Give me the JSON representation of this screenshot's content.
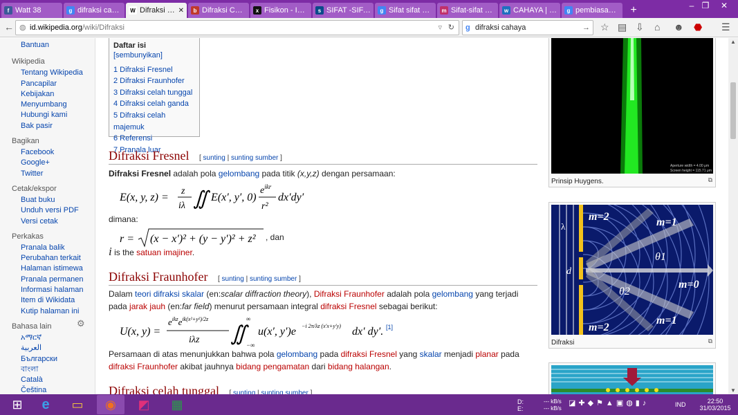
{
  "tabs": [
    {
      "label": "Watt 38",
      "icon": "f"
    },
    {
      "label": "difraksi caha...",
      "icon": "g"
    },
    {
      "label": "Difraksi - ...",
      "icon": "W",
      "active": true
    },
    {
      "label": "Difraksi Cah...",
      "icon": "b"
    },
    {
      "label": "Fisikon - Inte...",
      "icon": "x"
    },
    {
      "label": "SIFAT -SIFAT...",
      "icon": "s"
    },
    {
      "label": "Sifat sifat ca...",
      "icon": "g"
    },
    {
      "label": "Sifat-sifat Ca...",
      "icon": "m"
    },
    {
      "label": "CAHAYA | sc...",
      "icon": "w"
    },
    {
      "label": "pembiasan a...",
      "icon": "g"
    }
  ],
  "url": {
    "host": "id.wikipedia.org",
    "path": "/wiki/Difraksi"
  },
  "search": "difraksi cahaya",
  "sidebar": {
    "top_item": "Bantuan",
    "sections": [
      {
        "title": "Wikipedia",
        "items": [
          "Tentang Wikipedia",
          "Pancapilar",
          "Kebijakan",
          "Menyumbang",
          "Hubungi kami",
          "Bak pasir"
        ]
      },
      {
        "title": "Bagikan",
        "items": [
          "Facebook",
          "Google+",
          "Twitter"
        ]
      },
      {
        "title": "Cetak/ekspor",
        "items": [
          "Buat buku",
          "Unduh versi PDF",
          "Versi cetak"
        ]
      },
      {
        "title": "Perkakas",
        "items": [
          "Pranala balik",
          "Perubahan terkait",
          "Halaman istimewa",
          "Pranala permanen",
          "Informasi halaman",
          "Item di Wikidata",
          "Kutip halaman ini"
        ]
      },
      {
        "title": "Bahasa lain",
        "items": [
          "አማርኛ",
          "العربية",
          "Български",
          "বাংলা",
          "Català",
          "Čeština"
        ]
      }
    ]
  },
  "toc": {
    "title": "Daftar isi",
    "toggle": "[sembunyikan]",
    "items": [
      "1 Difraksi Fresnel",
      "2 Difraksi Fraunhofer",
      "3 Difraksi celah tunggal",
      "4 Difraksi celah ganda",
      "5 Difraksi celah majemuk",
      "6 Referensi",
      "7 Pranala luar"
    ]
  },
  "edit": {
    "open": "[",
    "edit": "sunting",
    "sep": "|",
    "source": "sunting sumber",
    "close": "]"
  },
  "sec1": {
    "title": "Difraksi Fresnel",
    "p1_b": "Difraksi Fresnel",
    "p1_a": " adalah pola ",
    "p1_link": "gelombang",
    "p1_c": " pada titik ",
    "p1_i": "(x,y,z)",
    "p1_d": " dengan persamaan:",
    "eq1": "E(x, y, z) = (z / iλ) ∬ E(x′, y′, 0) (e^{ikr} / r²) dx′dy′",
    "dimana": "dimana:",
    "eq2": "r = √((x − x′)² + (y − y′)² + z²)",
    "dan": ", dan",
    "i_sym": "i",
    "i_text": " is the ",
    "i_link": "satuan imajiner",
    "i_end": "."
  },
  "sec2": {
    "title": "Difraksi Fraunhofer",
    "t1": "Dalam ",
    "l1": "teori",
    "t2": " ",
    "l2": "difraksi skalar",
    "t3": " (en:",
    "i1": "scalar diffraction theory",
    "t4": "), ",
    "l3": "Difraksi Fraunhofer",
    "t5": " adalah pola ",
    "l4": "gelombang",
    "t6": " yang terjadi pada ",
    "l5": "jarak jauh",
    "t7": " (en:",
    "i2": "far field",
    "t8": ") menurut persamaan integral ",
    "l6": "difraksi Fresnel",
    "t9": " sebagai berikut:",
    "eq3": "U(x, y) = (e^{ikz} e^{ik(x²+y²)/2z} / iλz) ∬ u(x′, y′) e^{−i 2π/λz (x′x + y′y)} dx′ dy′.",
    "ref": "[1]",
    "p2a": "Persamaan di atas menunjukkan bahwa pola ",
    "p2l1": "gelombang",
    "p2b": " pada ",
    "p2l2": "difraksi Fresnel",
    "p2c": " yang ",
    "p2l3": "skalar",
    "p2d": " menjadi ",
    "p2l4": "planar",
    "p2e": " pada ",
    "p2l5": "difraksi Fraunhofer",
    "p2f": " akibat jauhnya ",
    "p2l6": "bidang pengamatan",
    "p2g": " dari ",
    "p2l7": "bidang halangan",
    "p2h": "."
  },
  "sec3": {
    "title": "Difraksi celah tunggal"
  },
  "img1": {
    "caption": "Prinsip Huygens.",
    "small1": "Aperture width = 4.00 μm",
    "small2": "Screen height = 115.71 μm"
  },
  "img2": {
    "caption": "Difraksi",
    "lambda": "λ",
    "d": "d",
    "labels": [
      "m=2",
      "m=1",
      "θ1",
      "m=0",
      "θ2",
      "m=1",
      "m=2"
    ]
  },
  "taskbar": {
    "drives": [
      "D:",
      "E:"
    ],
    "speeds": [
      "--- kB/s",
      "--- kB/s"
    ],
    "lang": "IND",
    "time": "22:50",
    "date": "31/03/2015"
  },
  "colors": {
    "tabbar": "#7d2ca5",
    "taskbar": "#6a2a8e",
    "heading": "#8b0000",
    "link": "#0645ad",
    "redlink": "#ba0000"
  }
}
